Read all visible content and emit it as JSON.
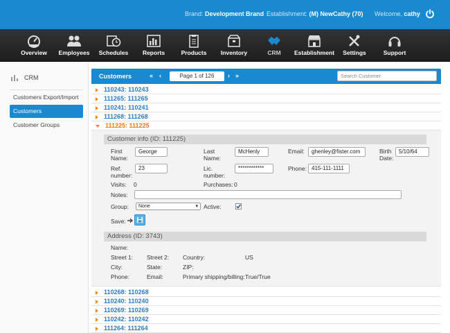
{
  "topbar": {
    "brand_label": "Brand:",
    "brand_value": "Development Brand",
    "establishment_label": "Establishment:",
    "establishment_value": "(M) NewCathy (70)",
    "welcome_label": "Welcome,",
    "user": "cathy"
  },
  "nav": [
    {
      "label": "Overview",
      "icon": "speedometer-icon"
    },
    {
      "label": "Employees",
      "icon": "people-icon"
    },
    {
      "label": "Schedules",
      "icon": "clock-calendar-icon"
    },
    {
      "label": "Reports",
      "icon": "bar-chart-icon"
    },
    {
      "label": "Products",
      "icon": "clipboard-icon"
    },
    {
      "label": "Inventory",
      "icon": "box-icon"
    },
    {
      "label": "CRM",
      "icon": "handshake-icon"
    },
    {
      "label": "Establishment",
      "icon": "storefront-icon"
    },
    {
      "label": "Settings",
      "icon": "tools-icon"
    },
    {
      "label": "Support",
      "icon": "headset-icon"
    }
  ],
  "sidebar": {
    "title": "CRM",
    "items": [
      {
        "label": "Customers Export/Import"
      },
      {
        "label": "Customers"
      },
      {
        "label": "Customer Groups"
      }
    ]
  },
  "grid": {
    "title": "Customers",
    "pager_first": "«",
    "pager_prev": "‹",
    "page_text": "Page 1 of 126",
    "pager_next": "›",
    "pager_last": "»",
    "search_placeholder": "Search Customer",
    "rows_top": [
      "110243: 110243",
      "111265: 111265",
      "110241: 110241",
      "111268: 111268"
    ],
    "open_row": "111225: 111225",
    "rows_bottom": [
      "110268: 110268",
      "110240: 110240",
      "110269: 110269",
      "110242: 110242",
      "111264: 111264"
    ]
  },
  "customer": {
    "section_title": "Customer info (ID: 111225)",
    "first_name_label": "First Name:",
    "first_name": "George",
    "last_name_label": "Last Name:",
    "last_name": "McHenly",
    "email_label": "Email:",
    "email": "ghenley@fister.com",
    "birth_label": "Birth Date:",
    "birth": "5/10/64",
    "ref_label": "Ref. number:",
    "ref": "23",
    "lic_label": "Lic. number:",
    "lic": "************",
    "phone_label": "Phone:",
    "phone": "415-111-1111",
    "visits_label": "Visits:",
    "visits": "0",
    "purchases_label": "Purchases:",
    "purchases": "0",
    "notes_label": "Notes:",
    "notes": "",
    "group_label": "Group:",
    "group": "None",
    "active_label": "Active:",
    "active": true,
    "save_label": "Save:"
  },
  "address": {
    "section_title": "Address (ID: 3743)",
    "name_label": "Name:",
    "street1_label": "Street 1:",
    "street2_label": "Street 2:",
    "country_label": "Country:",
    "country": "US",
    "city_label": "City:",
    "state_label": "State:",
    "zip_label": "ZIP:",
    "phone_label": "Phone:",
    "email_label": "Email:",
    "primary_label": "Primary shipping/billing:",
    "primary": "True/True"
  },
  "colors": {
    "accent": "#1a8ad0",
    "nav_bg": "#2a2a2a",
    "open_row": "#e07b10",
    "link": "#2a7bc0"
  }
}
